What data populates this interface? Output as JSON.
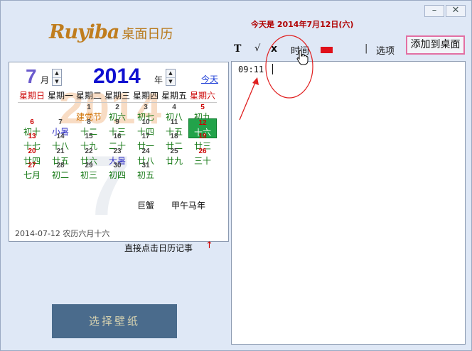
{
  "window": {
    "minimize_glyph": "–",
    "close_glyph": "✕",
    "today_text": "今天是 2014年7月12日(六)"
  },
  "logo": {
    "word": "Ruyiba",
    "cn": "桌面日历"
  },
  "toolbar": {
    "bold_t": "T",
    "check": "√",
    "delete_x": "x",
    "time": "时间",
    "separator": "|",
    "options": "选项",
    "add_to_desktop": "添加到桌面",
    "color_swatch": "#e0101a"
  },
  "calendar": {
    "month": "7",
    "month_unit": "月",
    "year": "2014",
    "year_unit": "年",
    "today_link": "今天",
    "spin_up": "▲",
    "spin_down": "▼",
    "watermark_year": "2014",
    "watermark_day": "7",
    "weekdays": [
      "星期日",
      "星期一",
      "星期二",
      "星期三",
      "星期四",
      "星期五",
      "星期六"
    ],
    "days": [
      {
        "n": "1",
        "l": "建党节",
        "t": "fest"
      },
      {
        "n": "2",
        "l": "初六"
      },
      {
        "n": "3",
        "l": "初七"
      },
      {
        "n": "4",
        "l": "初八"
      },
      {
        "n": "5",
        "l": "初九"
      },
      {
        "n": "6",
        "l": "初十"
      },
      {
        "n": "7",
        "l": "小暑",
        "t": "term"
      },
      {
        "n": "8",
        "l": "十二"
      },
      {
        "n": "9",
        "l": "十三"
      },
      {
        "n": "10",
        "l": "十四"
      },
      {
        "n": "11",
        "l": "十五"
      },
      {
        "n": "12",
        "l": "十六",
        "sel": true
      },
      {
        "n": "13",
        "l": "十七"
      },
      {
        "n": "14",
        "l": "十八"
      },
      {
        "n": "15",
        "l": "十九"
      },
      {
        "n": "16",
        "l": "二十"
      },
      {
        "n": "17",
        "l": "廿一"
      },
      {
        "n": "18",
        "l": "廿二"
      },
      {
        "n": "19",
        "l": "廿三"
      },
      {
        "n": "20",
        "l": "廿四"
      },
      {
        "n": "21",
        "l": "廿五"
      },
      {
        "n": "22",
        "l": "廿六"
      },
      {
        "n": "23",
        "l": "大暑",
        "t": "term"
      },
      {
        "n": "24",
        "l": "廿八"
      },
      {
        "n": "25",
        "l": "廿九"
      },
      {
        "n": "26",
        "l": "三十"
      },
      {
        "n": "27",
        "l": "七月"
      },
      {
        "n": "28",
        "l": "初二"
      },
      {
        "n": "29",
        "l": "初三"
      },
      {
        "n": "30",
        "l": "初四"
      },
      {
        "n": "31",
        "l": "初五"
      }
    ],
    "zodiac": "巨蟹",
    "ganzhi": "甲午马年",
    "footer": "2014-07-12 农历六月十六"
  },
  "hint": {
    "text": "直接点击日历记事",
    "arrow": "↑"
  },
  "wallpaper_button": "选择壁纸",
  "note": {
    "content": "09:11"
  },
  "colors": {
    "weekend": "#cc0000",
    "lunar": "#177a17",
    "selected": "#22a34a",
    "annotation": "#e02020"
  }
}
